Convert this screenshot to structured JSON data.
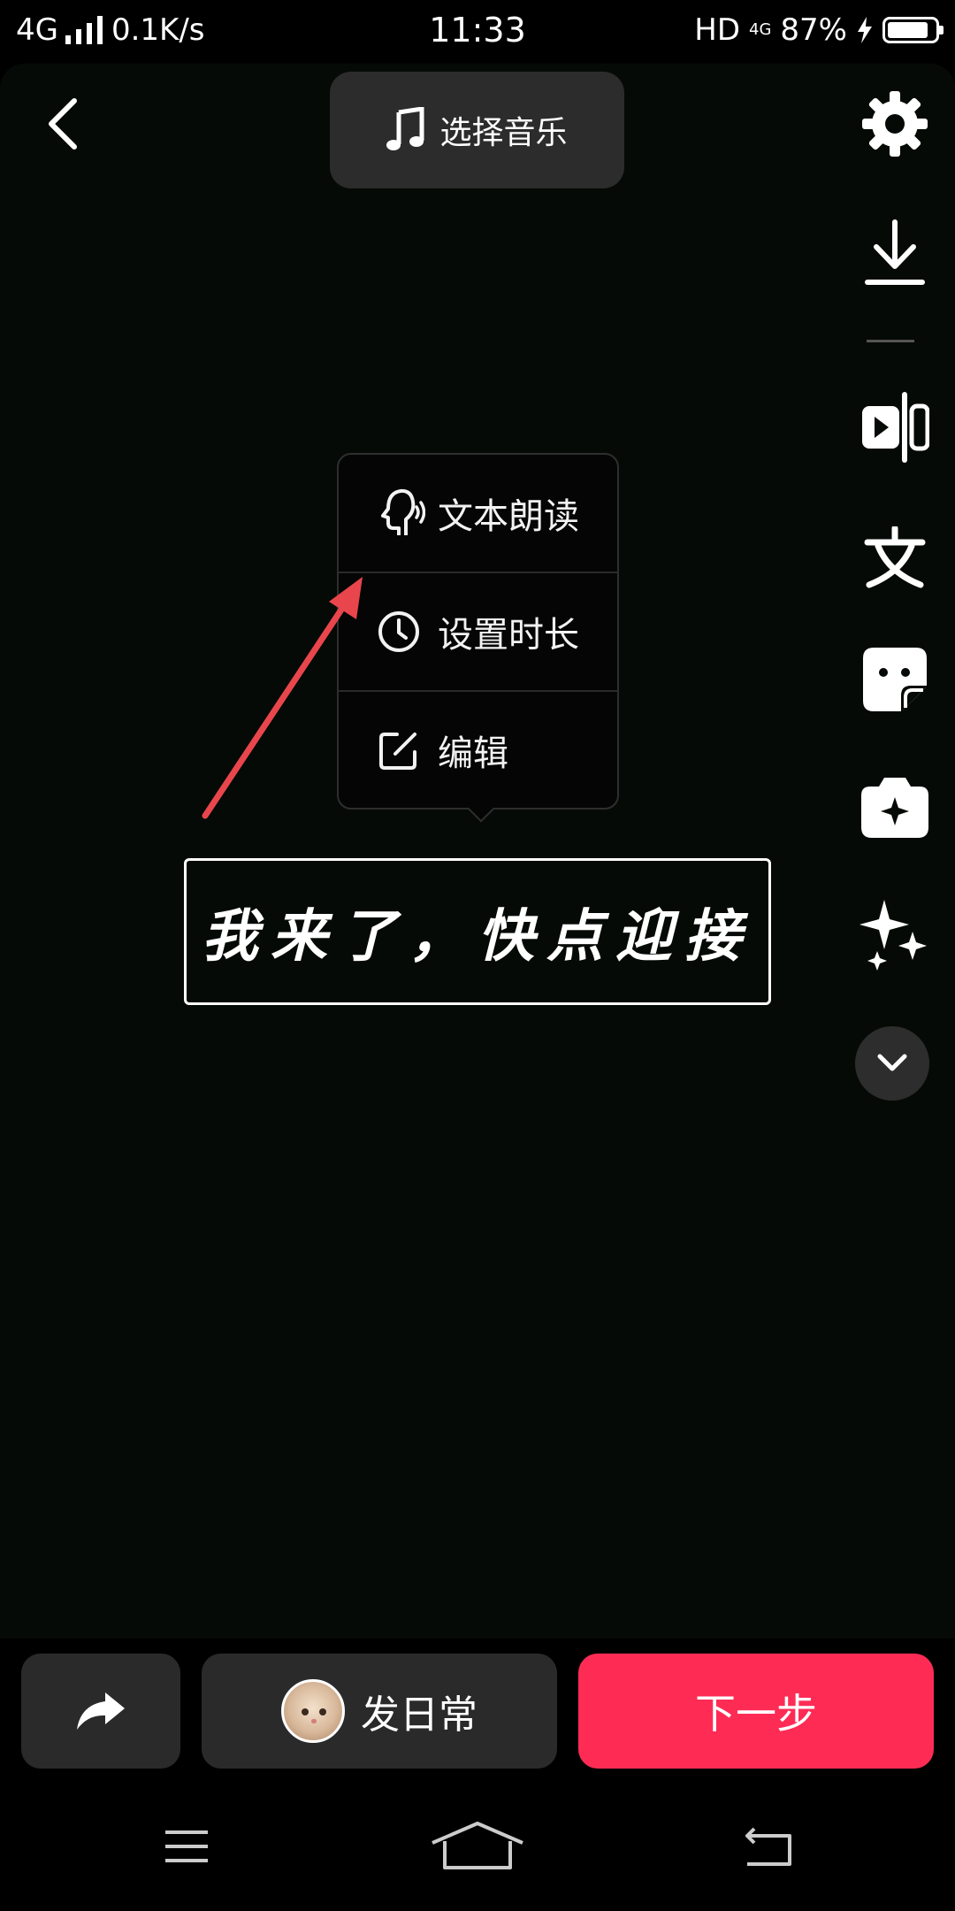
{
  "status_bar": {
    "network": "4G",
    "speed": "0.1K/s",
    "time": "11:33",
    "hd": "HD",
    "net_small": "4G",
    "battery": "87%",
    "battery_level": 0.87
  },
  "header": {
    "back_icon": "chevron-left-icon",
    "music_label": "选择音乐"
  },
  "toolbar": {
    "items": [
      "gear-icon",
      "download-icon",
      "split-clip-icon",
      "text-icon",
      "sticker-icon",
      "effects-icon",
      "sparkle-icon",
      "chevron-down-icon"
    ]
  },
  "popover": {
    "items": [
      {
        "icon": "speaking-head-icon",
        "label": "文本朗读"
      },
      {
        "icon": "clock-icon",
        "label": "设置时长"
      },
      {
        "icon": "edit-icon",
        "label": "编辑"
      }
    ]
  },
  "canvas": {
    "text_sticker": "我来了，快点迎接"
  },
  "bottom": {
    "share_icon": "share-arrow-icon",
    "daily_label": "发日常",
    "next_label": "下一步"
  },
  "nav": {
    "items": [
      "menu-icon",
      "home-icon",
      "back-icon"
    ]
  },
  "colors": {
    "accent": "#fe2c55",
    "annotation": "#e8464c",
    "background": "#000000"
  }
}
